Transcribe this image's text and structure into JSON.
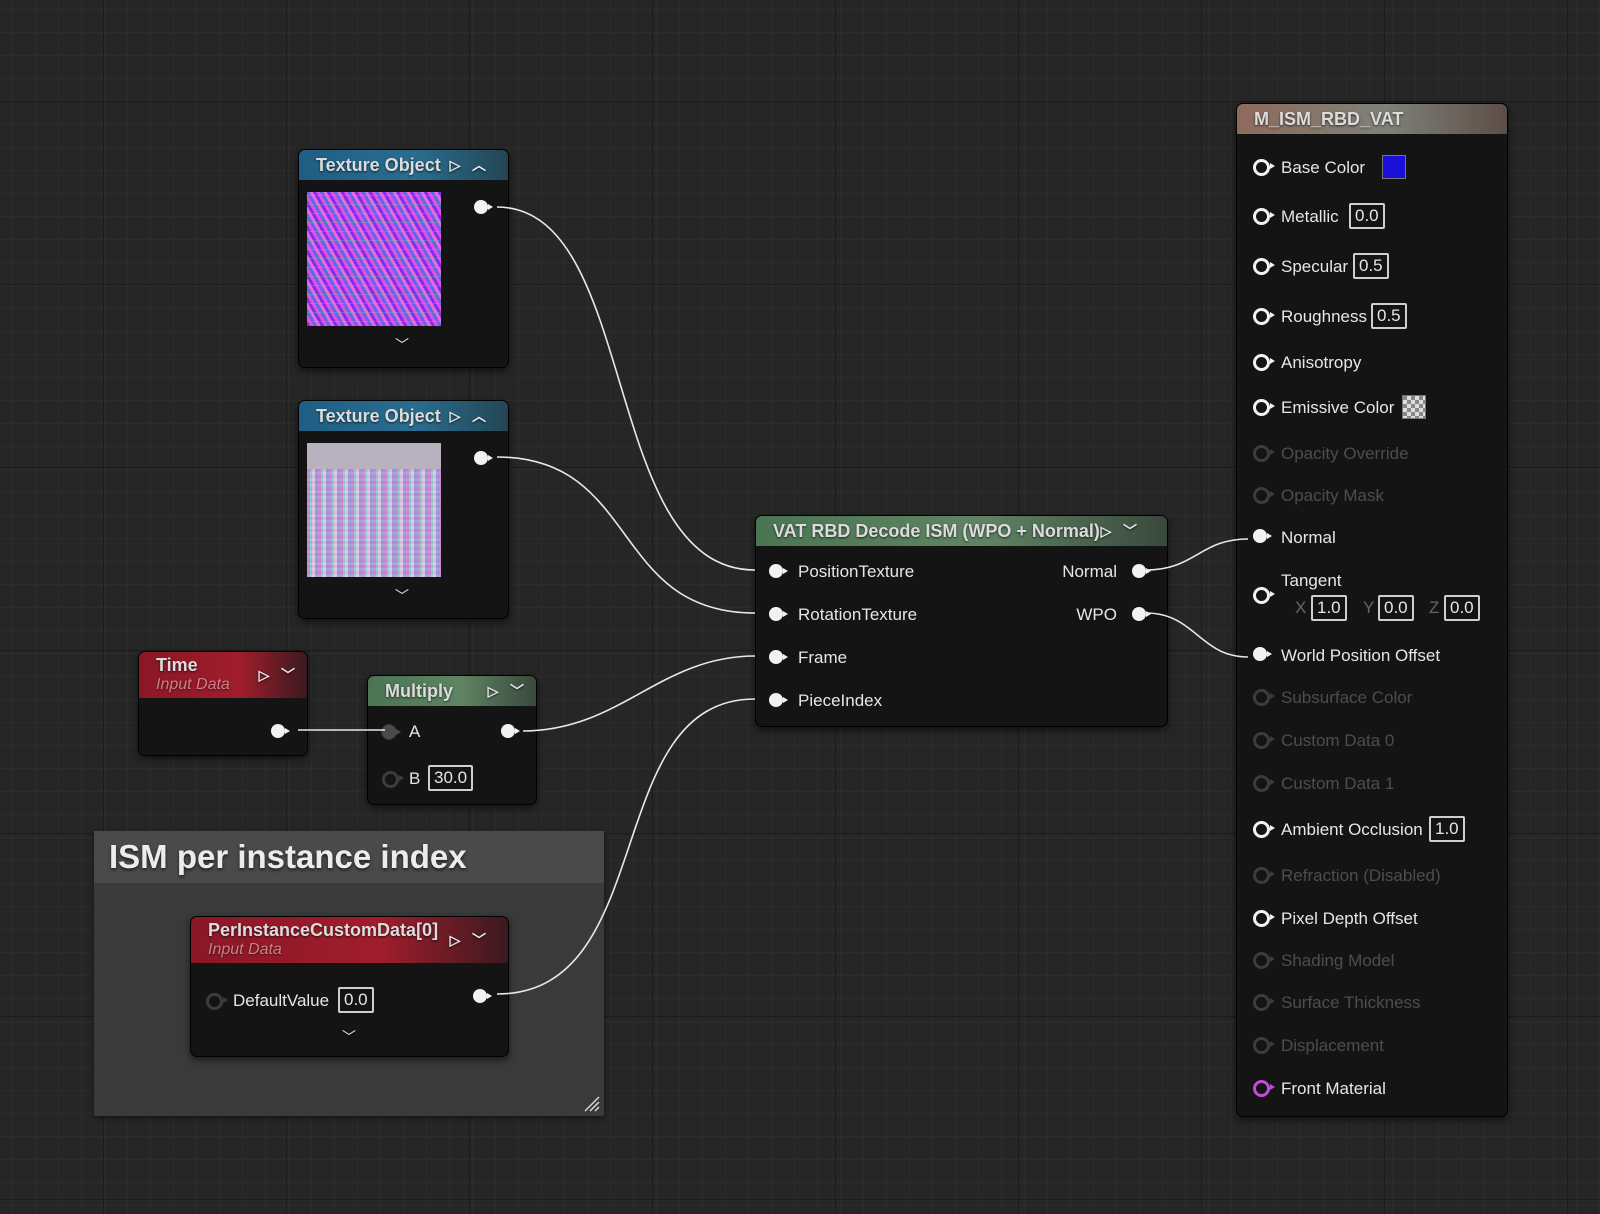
{
  "texture_nodes": [
    {
      "title": "Texture Object"
    },
    {
      "title": "Texture Object"
    }
  ],
  "time_node": {
    "title": "Time",
    "subtitle": "Input Data"
  },
  "multiply_node": {
    "title": "Multiply",
    "input_a": "A",
    "input_b": "B",
    "b_value": "30.0"
  },
  "comment_box": {
    "title": "ISM per instance index"
  },
  "custom_data_node": {
    "title": "PerInstanceCustomData[0]",
    "subtitle": "Input Data",
    "input_label": "DefaultValue",
    "input_value": "0.0"
  },
  "vat_node": {
    "title": "VAT RBD Decode ISM (WPO + Normal)",
    "inputs": [
      "PositionTexture",
      "RotationTexture",
      "Frame",
      "PieceIndex"
    ],
    "outputs": [
      "Normal",
      "WPO"
    ]
  },
  "material_node": {
    "title": "M_ISM_RBD_VAT",
    "pins": [
      {
        "label": "Base Color",
        "enabled": true
      },
      {
        "label": "Metallic",
        "enabled": true,
        "value": "0.0"
      },
      {
        "label": "Specular",
        "enabled": true,
        "value": "0.5"
      },
      {
        "label": "Roughness",
        "enabled": true,
        "value": "0.5"
      },
      {
        "label": "Anisotropy",
        "enabled": true
      },
      {
        "label": "Emissive Color",
        "enabled": true
      },
      {
        "label": "Opacity Override",
        "enabled": false
      },
      {
        "label": "Opacity Mask",
        "enabled": false
      },
      {
        "label": "Normal",
        "enabled": true,
        "connected": true
      },
      {
        "label": "Tangent",
        "enabled": true
      },
      {
        "label": "World Position Offset",
        "enabled": true,
        "connected": true
      },
      {
        "label": "Subsurface Color",
        "enabled": false
      },
      {
        "label": "Custom Data 0",
        "enabled": false
      },
      {
        "label": "Custom Data 1",
        "enabled": false
      },
      {
        "label": "Ambient Occlusion",
        "enabled": true,
        "value": "1.0"
      },
      {
        "label": "Refraction (Disabled)",
        "enabled": false
      },
      {
        "label": "Pixel Depth Offset",
        "enabled": true
      },
      {
        "label": "Shading Model",
        "enabled": false
      },
      {
        "label": "Surface Thickness",
        "enabled": false
      },
      {
        "label": "Displacement",
        "enabled": false
      },
      {
        "label": "Front Material",
        "enabled": true
      }
    ],
    "base_color": "#1a0fd6",
    "tangent": {
      "x_label": "X",
      "x": "1.0",
      "y_label": "Y",
      "y": "0.0",
      "z_label": "Z",
      "z": "0.0"
    }
  }
}
